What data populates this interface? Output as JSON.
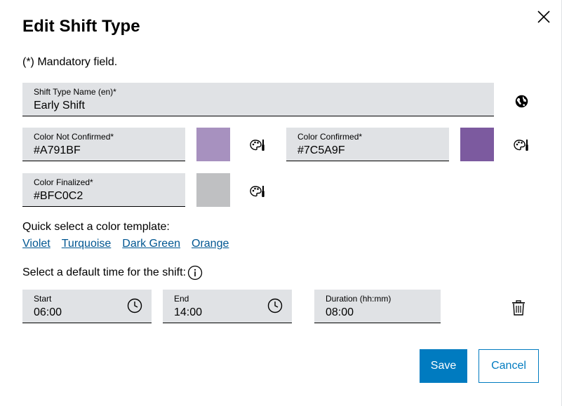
{
  "dialog": {
    "title": "Edit Shift Type",
    "mandatory_note": "(*) Mandatory field."
  },
  "shift_name": {
    "label": "Shift Type Name (en)*",
    "value": "Early Shift"
  },
  "colors": {
    "not_confirmed": {
      "label": "Color Not Confirmed*",
      "value": "#A791BF",
      "swatch": "#A791BF"
    },
    "confirmed": {
      "label": "Color Confirmed*",
      "value": "#7C5A9F",
      "swatch": "#7C5A9F"
    },
    "finalized": {
      "label": "Color Finalized*",
      "value": "#BFC0C2",
      "swatch": "#BFC0C2"
    }
  },
  "templates": {
    "label": "Quick select a color template:",
    "items": [
      "Violet",
      "Turquoise",
      "Dark Green",
      "Orange"
    ]
  },
  "time": {
    "label": "Select a default time for the shift:",
    "start": {
      "label": "Start",
      "value": "06:00"
    },
    "end": {
      "label": "End",
      "value": "14:00"
    },
    "duration": {
      "label": "Duration (hh:mm)",
      "value": "08:00"
    }
  },
  "buttons": {
    "save": "Save",
    "cancel": "Cancel"
  },
  "icons": {
    "close": "close-icon",
    "language": "globe-icon",
    "color_picker": "palette-icon",
    "info": "info-icon",
    "clock": "clock-icon",
    "delete": "trash-icon"
  },
  "theme": {
    "primary": "#007bc0",
    "link": "#005691",
    "field_bg": "#e0e2e5"
  }
}
